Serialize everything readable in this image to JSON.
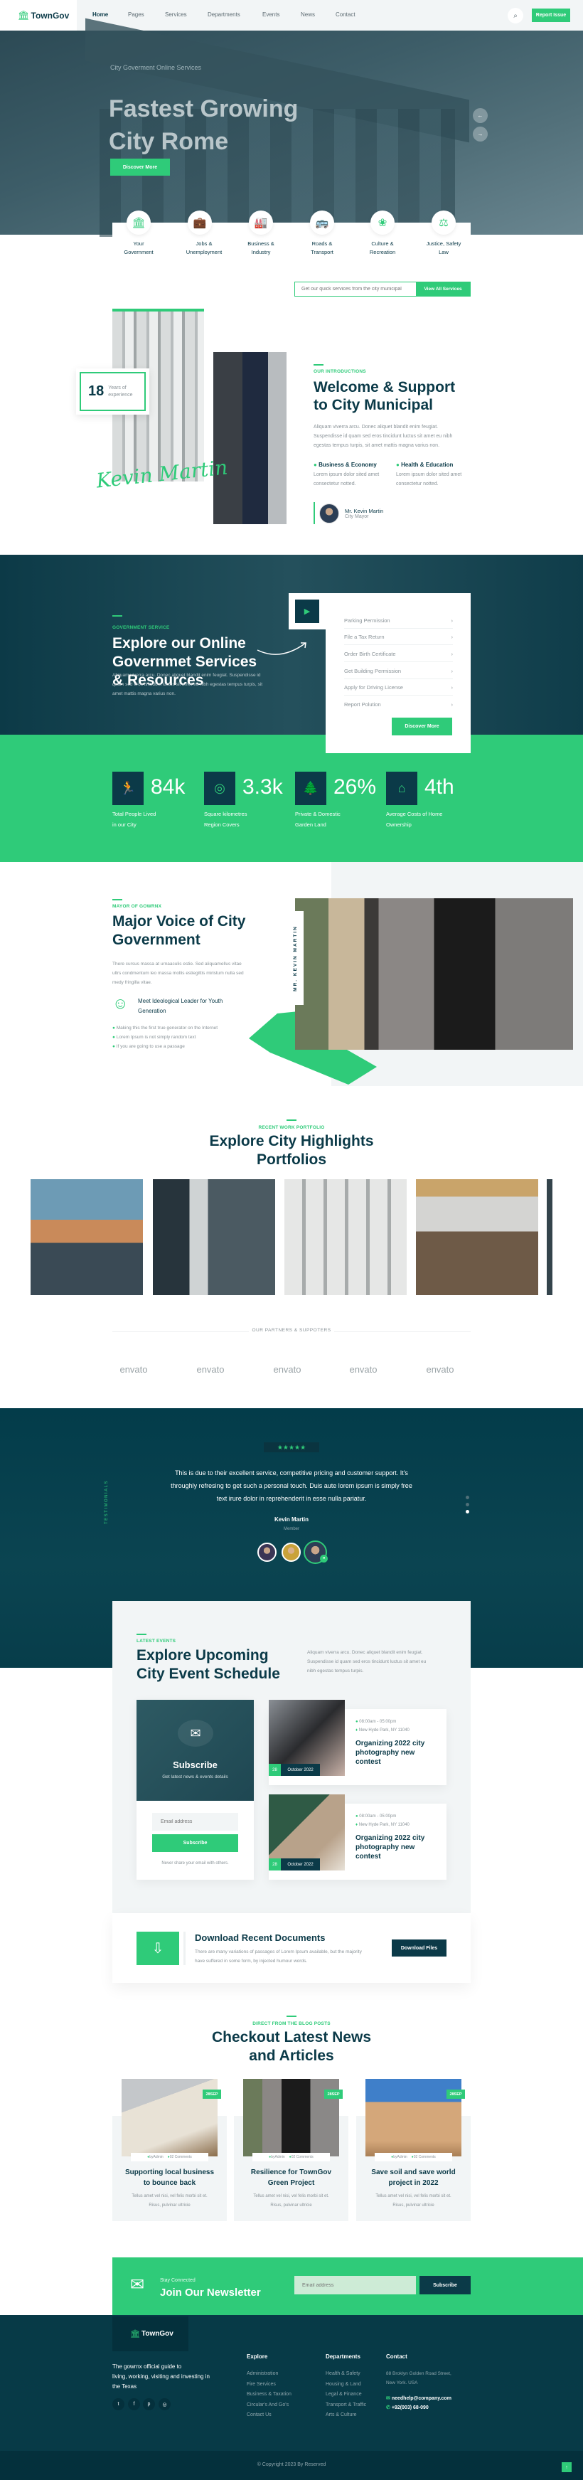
{
  "colors": {
    "accent": "#2fcb79",
    "dark": "#0b3a48",
    "light": "#f2f5f6"
  },
  "header": {
    "logo": "TownGov",
    "nav": [
      "Home",
      "Pages",
      "Services",
      "Departments",
      "Events",
      "News",
      "Contact"
    ],
    "report_button": "Report Issue",
    "search_icon": "search-icon"
  },
  "hero": {
    "subtitle": "City Goverment Online Services",
    "title_line1": "Fastest Growing",
    "title_line2": "City Rome",
    "button": "Discover More"
  },
  "services": [
    {
      "label1": "Your",
      "label2": "Government",
      "icon": "government-building-icon"
    },
    {
      "label1": "Jobs &",
      "label2": "Unemployment",
      "icon": "briefcase-icon"
    },
    {
      "label1": "Business &",
      "label2": "Industry",
      "icon": "factory-icon"
    },
    {
      "label1": "Roads &",
      "label2": "Transport",
      "icon": "bus-icon"
    },
    {
      "label1": "Culture &",
      "label2": "Recreation",
      "icon": "lotus-icon"
    },
    {
      "label1": "Justice, Safety",
      "label2": "Law",
      "icon": "scales-icon"
    }
  ],
  "quick": {
    "placeholder": "Get our quick services from the city municipal",
    "button": "View All Services"
  },
  "about": {
    "years": "18",
    "years_label1": "Years of",
    "years_label2": "experience",
    "signature": "Kevin Martin",
    "label": "OUR INTRODUCTIONS",
    "title1": "Welcome & Support",
    "title2": "to City Municipal",
    "para": [
      "Aliquam viverra arcu. Donec aliquet blandit enim feugiat.",
      "Suspendisse id quam sed eros tincidunt luctus sit amet eu nibh",
      "egestas tempus turpis, sit amet mattis magna varius non."
    ],
    "features": [
      {
        "title": "Business & Economy",
        "text1": "Lorem ipsum dolor sited amet",
        "text2": "consectetur notted."
      },
      {
        "title": "Health & Education",
        "text1": "Lorem ipsum dolor sited amet",
        "text2": "consectetur notted."
      }
    ],
    "author_name": "Mr. Kevin Martin",
    "author_role": "City Mayor"
  },
  "gov": {
    "label": "GOVERNMENT SERVICE",
    "title": [
      "Explore our Online",
      "Governmet Services",
      "& Resources"
    ],
    "para": [
      "Aliquam viverra arcu. Donec aliquet blandit enim feugiat. Suspendisse id",
      "quam sed eros tincidunt luctus sit amet eu nibh egestas tempus turpis, sit",
      "amet mattis magna varius non."
    ],
    "list": [
      "Parking Permission",
      "File a Tax Return",
      "Order Birth Certificate",
      "Get Building Permission",
      "Apply for Driving License",
      "Report Polution"
    ],
    "button": "Discover More"
  },
  "stats": [
    {
      "value": "84k",
      "l1": "Total People Lived",
      "l2": "in our City",
      "icon": "running-person-icon"
    },
    {
      "value": "3.3k",
      "l1": "Square kilometres",
      "l2": "Region Covers",
      "icon": "map-fingerprint-icon"
    },
    {
      "value": "26%",
      "l1": "Private & Domestic",
      "l2": "Garden Land",
      "icon": "tree-icon"
    },
    {
      "value": "4th",
      "l1": "Average Costs of Home",
      "l2": "Ownership",
      "icon": "barn-icon"
    }
  ],
  "mayor": {
    "label": "MAYOR OF GOWRNX",
    "title1": "Major Voice of City",
    "title2": "Government",
    "para": [
      "There cursus massa at urnaaculis estie. Sed aliquamellus vitae",
      "ultrs condmentum leo massa mollis estiegittis miristum nulla sed",
      "medy fringilla vitae."
    ],
    "leader1": "Meet Ideological Leader for Youth",
    "leader2": "Generation",
    "checks": [
      "Making this the first true generator on the Internet",
      "Lorem Ipsum is not simply random text",
      "If you are going to use a passage"
    ],
    "vertical": "MR. KEVIN MARTIN"
  },
  "portfolio": {
    "label": "RECENT WORK PORTFOLIO",
    "title1": "Explore City Highlights",
    "title2": "Portfolios"
  },
  "partners": {
    "label": "OUR PARTNERS & SUPPOTERS",
    "logos": [
      "envato",
      "envato",
      "envato",
      "envato",
      "envato"
    ]
  },
  "testimonial": {
    "side": "TESTIMONIALS",
    "rating": 5,
    "stars": "★★★★★",
    "quote": [
      "This is due to their excellent service, competitive pricing and customer support. It's",
      "throughly refresing to get such a personal touch. Duis aute lorem ipsum is simply free",
      "text irure dolor in reprehenderit in esse nulla pariatur."
    ],
    "name": "Kevin Martin",
    "role": "Member",
    "active_slide": 3
  },
  "events": {
    "label": "LATEST EVENTS",
    "title1": "Explore Upcoming",
    "title2": "City Event Schedule",
    "para": [
      "Aliquam viverra arcu. Donec aliquet blandit enim feugiat.",
      "Suspendisse id quam sed eros tincidunt luctus sit amet eu",
      "nibh egestas tempus turpis."
    ],
    "subscribe_title": "Subscribe",
    "subscribe_sub": "Get latest news & events details",
    "email_placeholder": "Email address",
    "subscribe_button": "Subscribe",
    "note": "Never share your email with others.",
    "items": [
      {
        "time": "08:00am - 05:00pm",
        "location": "New Hyde Park, NY 11040",
        "title": [
          "Organizing 2022 city",
          "photography new",
          "contest"
        ],
        "day": "28",
        "month": "October 2022"
      },
      {
        "time": "08:00am - 05:00pm",
        "location": "New Hyde Park, NY 11040",
        "title": [
          "Organizing 2022 city",
          "photography new",
          "contest"
        ],
        "day": "28",
        "month": "October 2022"
      }
    ]
  },
  "download": {
    "title": "Download Recent Documents",
    "text1": "There are many variations of passages of Lorem Ipsum available, but the majority",
    "text2": "have suffered in some form, by injected humour words.",
    "button": "Download Files"
  },
  "blog": {
    "label": "DIRECT FROM THE BLOG POSTS",
    "title1": "Checkout Latest News",
    "title2": "and Articles",
    "posts": [
      {
        "date": "28SEP",
        "author": "byAdmin",
        "comments": "02 Comments",
        "t1": "Supporting local business",
        "t2": "to bounce back",
        "x1": "Tellus amet vel nisi, vel felis morbi sit et.",
        "x2": "Risus, pulvinar ultricie"
      },
      {
        "date": "28SEP",
        "author": "byAdmin",
        "comments": "02 Comments",
        "t1": "Resilience for TownGov",
        "t2": "Green Project",
        "x1": "Tellus amet vel nisi, vel felis morbi sit et.",
        "x2": "Risus, pulvinar ultricie"
      },
      {
        "date": "28SEP",
        "author": "byAdmin",
        "comments": "02 Comments",
        "t1": "Save soil and save world",
        "t2": "project in 2022",
        "x1": "Tellus amet vel nisi, vel felis morbi sit et.",
        "x2": "Risus, pulvinar ultricie"
      }
    ]
  },
  "newsletter": {
    "small": "Stay Connected",
    "title": "Join Our Newsletter",
    "placeholder": "Email address",
    "button": "Subscribe"
  },
  "footer": {
    "logo": "TownGov",
    "tagline": [
      "The gowrnx official guide to",
      "living, working, visiting and investing in",
      "the Texas"
    ],
    "explore_title": "Explore",
    "explore": [
      "Administration",
      "Fire Services",
      "Business & Taxation",
      "Circular's And Go's",
      "Contact Us"
    ],
    "dept_title": "Departments",
    "depts": [
      "Health & Safety",
      "Housing & Land",
      "Legal & Finance",
      "Transport & Traffic",
      "Arts & Culture"
    ],
    "contact_title": "Contact",
    "address1": "88 Broklyn Golden Road Street,",
    "address2": "New York. USA",
    "email": "needhelp@company.com",
    "phone": "+92(003) 68-090",
    "socials": [
      "twitter-icon",
      "facebook-icon",
      "pinterest-icon",
      "instagram-icon"
    ],
    "copyright": "© Copyright 2023 By Reserved"
  }
}
